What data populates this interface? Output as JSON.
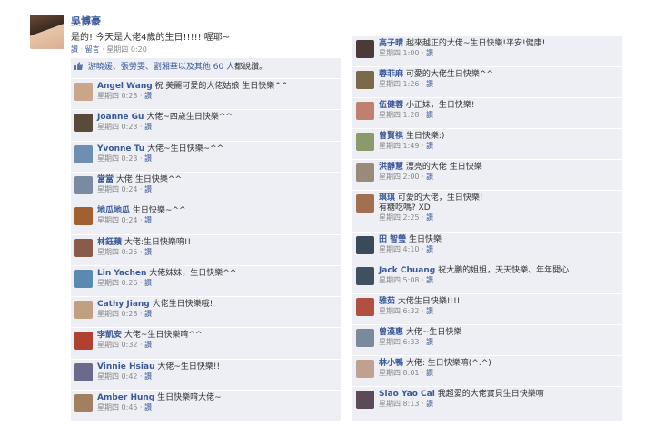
{
  "post": {
    "author": "吳博豪",
    "text": "是的! 今天是大佬4歲的生日!!!!! 喔耶~",
    "like_action": "讚",
    "comment_action": "留言",
    "time": "星期四 0:20"
  },
  "likes": {
    "names": "游曉媛、張勞雯、劉湘華以及其他",
    "count": "60 人",
    "suffix": "都說讚。"
  },
  "like_label": "讚",
  "left_comments": [
    {
      "name": "Angel Wang",
      "text": "祝 美麗可愛的大佬姑娘 生日快樂^^",
      "time": "星期四 0:23",
      "color": "#c9a58a"
    },
    {
      "name": "Joanne Gu",
      "text": "大佬~四歲生日快樂^^",
      "time": "星期四 0:23",
      "color": "#5a4a3a"
    },
    {
      "name": "Yvonne Tu",
      "text": "大佬~生日快樂~^^",
      "time": "星期四 0:23",
      "color": "#6f8fb0"
    },
    {
      "name": "當當",
      "text": "大佬:生日快樂^^",
      "time": "星期四 0:24",
      "color": "#7a8aa0"
    },
    {
      "name": "地瓜地瓜",
      "text": "生日快樂~^^",
      "time": "星期四 0:24",
      "color": "#a06030"
    },
    {
      "name": "林鈺蘋",
      "text": "大佬:生日快樂唷!!",
      "time": "星期四 0:25",
      "color": "#8a5a4a"
    },
    {
      "name": "Lin Yachen",
      "text": "大佬妹妹，生日快樂^^",
      "time": "星期四 0:26",
      "color": "#5a8ab0"
    },
    {
      "name": "Cathy Jiang",
      "text": "大佬生日快樂哦!",
      "time": "星期四 0:28",
      "color": "#c0a080"
    },
    {
      "name": "李凱安",
      "text": "大佬~生日快樂唷^^",
      "time": "星期四 0:32",
      "color": "#b04030"
    },
    {
      "name": "Vinnie Hsiau",
      "text": "大佬~生日快樂!!",
      "time": "星期四 0:42",
      "color": "#6a6a8a"
    },
    {
      "name": "Amber Hung",
      "text": "生日快樂唷大佬~",
      "time": "星期四 0:45",
      "color": "#a08060"
    }
  ],
  "right_comments": [
    {
      "name": "高子晴",
      "text": "越來越正的大佬~生日快樂!平安!健康!",
      "time": "星期四 1:00",
      "color": "#4a3a3a"
    },
    {
      "name": "蓉菲麻",
      "text": "可愛的大佬生日快樂^^",
      "time": "星期四 1:26",
      "color": "#7a6a4a"
    },
    {
      "name": "伍健蓉",
      "text": "小正妹，生日快樂!",
      "time": "星期四 1:28",
      "color": "#c08070"
    },
    {
      "name": "曾賢祺",
      "text": "生日快樂:)",
      "time": "星期四 1:49",
      "color": "#8a9a6a"
    },
    {
      "name": "洪靜慧",
      "text": "漂亮的大佬 生日快樂",
      "time": "星期四 2:00",
      "color": "#9a8a7a"
    },
    {
      "name": "琪琪",
      "text": "可愛的大佬，生日快樂!",
      "text2": "有糖吃嗎? XD",
      "time": "星期四 2:25",
      "color": "#a07050"
    },
    {
      "name": "田 智瑩",
      "text": "生日快樂",
      "time": "星期四 4:10",
      "color": "#3a4a5a"
    },
    {
      "name": "Jack Chuang",
      "text": "祝大鵬的姐姐，天天快樂、年年開心",
      "time": "星期四 5:08",
      "color": "#405060"
    },
    {
      "name": "雅茹",
      "text": "大佬生日快樂!!!!",
      "time": "星期四 6:32",
      "color": "#b05040"
    },
    {
      "name": "曾漢惠",
      "text": "大佬~生日快樂",
      "time": "星期四 6:33",
      "color": "#7a8a9a"
    },
    {
      "name": "林小鴨",
      "text": "大佬: 生日快樂唷(^.^)",
      "time": "星期四 8:01",
      "color": "#c0a090"
    },
    {
      "name": "Siao Yao Cai",
      "text": "我超愛的大佬寶貝生日快樂唷",
      "time": "星期四 8:13",
      "color": "#5a4a5a"
    }
  ]
}
